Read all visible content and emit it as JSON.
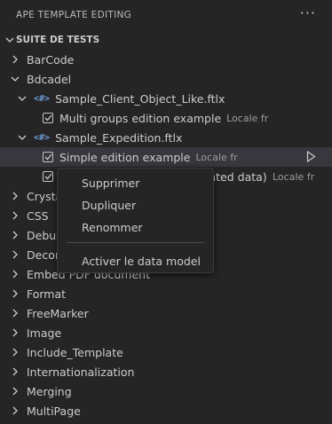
{
  "panel": {
    "title": "APE TEMPLATE EDITING",
    "more_label": "···"
  },
  "section": {
    "label": "SUITE DE TESTS"
  },
  "tree": {
    "barcode": "BarCode",
    "bdcadel": "Bdcadel",
    "file1": "Sample_Client_Object_Like.ftlx",
    "file1_test": "Multi groups edition example",
    "file1_locale": "Locale fr",
    "file2": "Sample_Expedition.ftlx",
    "file2_test1": "Simple edition example",
    "file2_test1_locale": "Locale fr",
    "file2_test2_tail": "lated data)",
    "file2_test2_locale": "Locale fr",
    "crysta": "Crysta",
    "css": "CSS",
    "debug": "Debug",
    "decor": "Decor",
    "embed": "Embed PDF document",
    "format": "Format",
    "freemarker": "FreeMarker",
    "image": "Image",
    "include": "Include_Template",
    "i18n": "Internationalization",
    "merging": "Merging",
    "multipage": "MultiPage"
  },
  "context_menu": {
    "delete": "Supprimer",
    "duplicate": "Dupliquer",
    "rename": "Renommer",
    "data_model": "Activer le data model"
  }
}
